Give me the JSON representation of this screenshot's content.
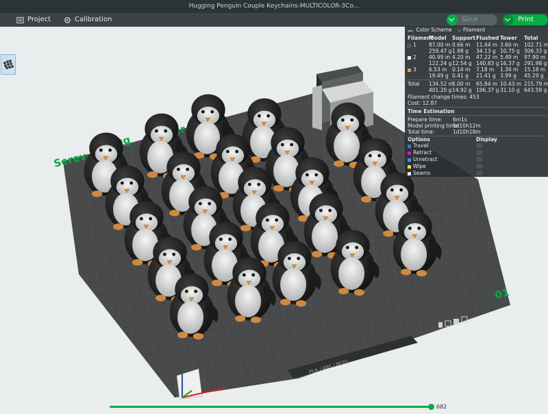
{
  "window": {
    "title": "Hugging Penguin Couple Keychains-MULTICOLOR-3Co..."
  },
  "toolbar": {
    "project_label": "Project",
    "calibration_label": "Calibration",
    "slice_label": "Slice plate",
    "print_label": "Print plate"
  },
  "plate": {
    "text_left": "Serev",
    "text_mid": "ugg",
    "text_mid2": "er",
    "plate_number": "01",
    "plate_name": "PLA / ABS / PETG"
  },
  "panel": {
    "scheme_label": "Color Scheme",
    "scheme_value": "Filament",
    "headers": [
      "Filament",
      "Model",
      "Support",
      "Flushed",
      "Tower",
      "Total"
    ],
    "filaments": [
      {
        "id": "1",
        "color": "#3a3a3a",
        "model": [
          "87.00 m",
          "259.47 g"
        ],
        "support": [
          "0.66 m",
          "1.98 g"
        ],
        "flushed": [
          "11.44 m",
          "34.13 g"
        ],
        "tower": [
          "3.60 m",
          "10.75 g"
        ],
        "total": [
          "102.71 m",
          "306.33 g"
        ]
      },
      {
        "id": "2",
        "color": "#ffffff",
        "model": [
          "40.99 m",
          "122.24 g"
        ],
        "support": [
          "4.20 m",
          "12.54 g"
        ],
        "flushed": [
          "47.22 m",
          "140.83 g"
        ],
        "tower": [
          "5.49 m",
          "16.37 g"
        ],
        "total": [
          "97.90 m",
          "291.98 g"
        ]
      },
      {
        "id": "3",
        "color": "#e0a050",
        "model": [
          "6.53 m",
          "19.49 g"
        ],
        "support": [
          "0.14 m",
          "0.41 g"
        ],
        "flushed": [
          "7.18 m",
          "21.41 g"
        ],
        "tower": [
          "1.34 m",
          "3.99 g"
        ],
        "total": [
          "15.18 m",
          "45.29 g"
        ]
      }
    ],
    "total_row": {
      "label": "Total",
      "model": [
        "134.52 m",
        "401.20 g"
      ],
      "support": [
        "5.00 m",
        "14.92 g"
      ],
      "flushed": [
        "65.84 m",
        "196.37 g"
      ],
      "tower": [
        "10.43 m",
        "31.10 g"
      ],
      "total": [
        "215.79 m",
        "643.59 g"
      ]
    },
    "change_times": "Filament change times: 453",
    "cost": "Cost: 12.87",
    "time_title": "Time Estimation",
    "prepare_label": "Prepare time:",
    "prepare_value": "6m1s",
    "model_label": "Model printing time:",
    "model_value": "1d10h12m",
    "total_label": "Total time:",
    "total_value": "1d10h18m",
    "options_label": "Options",
    "display_label": "Display",
    "options": [
      {
        "label": "Travel",
        "color": "#4d6de0"
      },
      {
        "label": "Retract",
        "color": "#c020c0"
      },
      {
        "label": "Unretract",
        "color": "#20a0e0"
      },
      {
        "label": "Wipe",
        "color": "#f0e020"
      },
      {
        "label": "Seams",
        "color": "#e8e8e8"
      }
    ]
  },
  "layer_slider": {
    "value": "682",
    "progress": 1.0
  },
  "colors": {
    "accent": "#00ae42",
    "toolbar": "#3a4447",
    "titlebar": "#2b3336"
  }
}
